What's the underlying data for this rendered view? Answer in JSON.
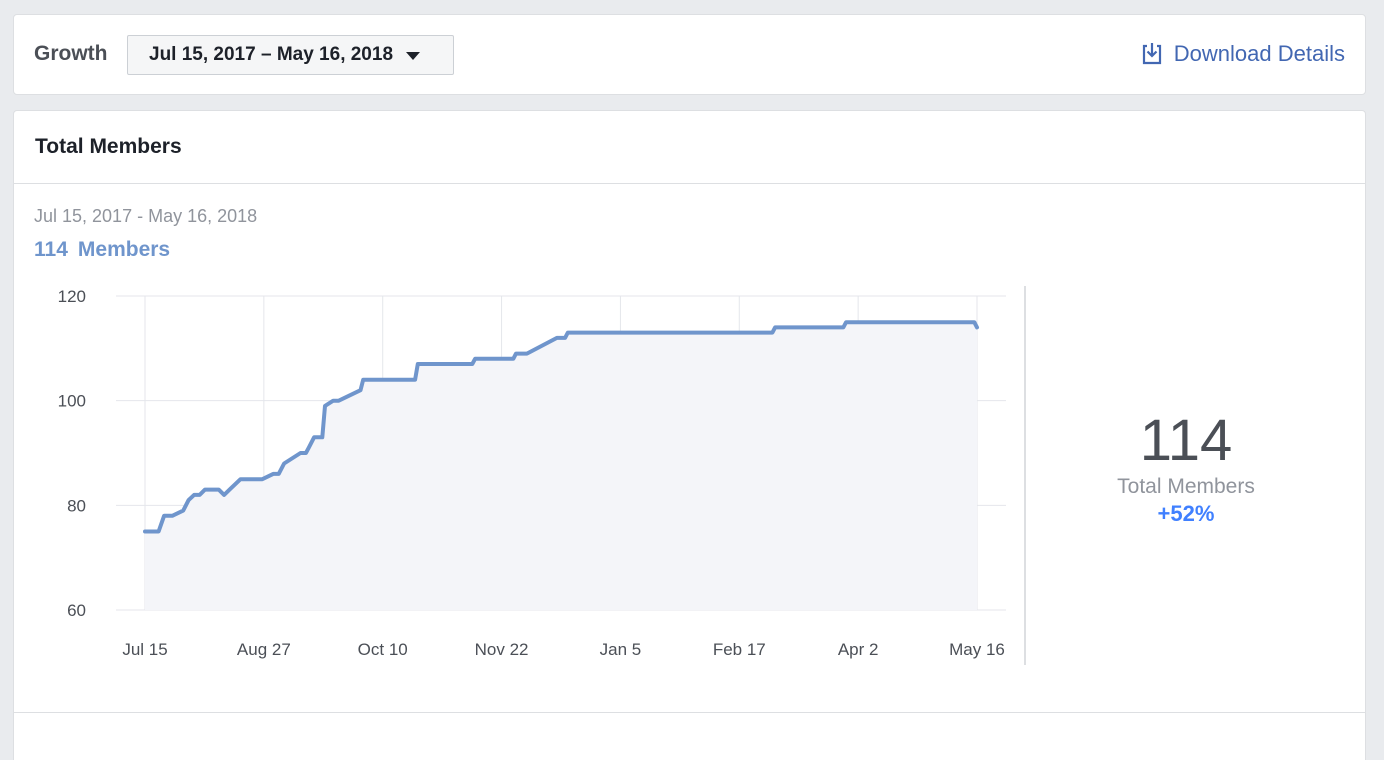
{
  "toolbar": {
    "title": "Growth",
    "date_range": "Jul 15, 2017 – May 16, 2018",
    "download_label": "Download Details"
  },
  "card": {
    "title": "Total Members",
    "range": "Jul 15, 2017 - May 16, 2018",
    "count": "114",
    "count_label": "Members"
  },
  "summary": {
    "value": "114",
    "label": "Total Members",
    "change": "+52%"
  },
  "colors": {
    "line": "#6f95cc",
    "fill": "#f4f5f9",
    "accent": "#4267b2",
    "positive": "#4080ff"
  },
  "chart_data": {
    "type": "area",
    "ylim": [
      60,
      120
    ],
    "yticks": [
      60,
      80,
      100,
      120
    ],
    "xlabels": [
      "Jul 15",
      "Aug 27",
      "Oct 10",
      "Nov 22",
      "Jan 5",
      "Feb 17",
      "Apr 2",
      "May 16"
    ],
    "xlim": [
      0,
      305
    ],
    "grid": true,
    "series": [
      {
        "x": [
          0,
          3,
          5,
          7,
          10,
          14,
          16,
          18,
          20,
          22,
          27,
          29,
          31,
          35,
          43,
          47,
          49,
          51,
          57,
          59,
          60,
          62,
          64,
          65,
          66,
          69,
          71,
          79,
          80,
          81,
          82,
          84,
          88,
          99,
          100,
          109,
          110,
          120,
          121,
          123,
          124,
          135,
          136,
          138,
          140,
          151,
          152,
          154,
          155,
          161,
          230,
          231,
          232,
          256,
          257,
          258,
          304,
          305
        ],
        "y": [
          75,
          75,
          75,
          78,
          78,
          79,
          81,
          82,
          82,
          83,
          83,
          82,
          83,
          85,
          85,
          86,
          86,
          88,
          90,
          90,
          91,
          93,
          93,
          93,
          99,
          100,
          100,
          102,
          104,
          104,
          104,
          104,
          104,
          104,
          107,
          107,
          107,
          107,
          108,
          108,
          108,
          108,
          109,
          109,
          109,
          112,
          112,
          112,
          113,
          113,
          113,
          114,
          114,
          114,
          115,
          115,
          115,
          114
        ]
      }
    ]
  }
}
